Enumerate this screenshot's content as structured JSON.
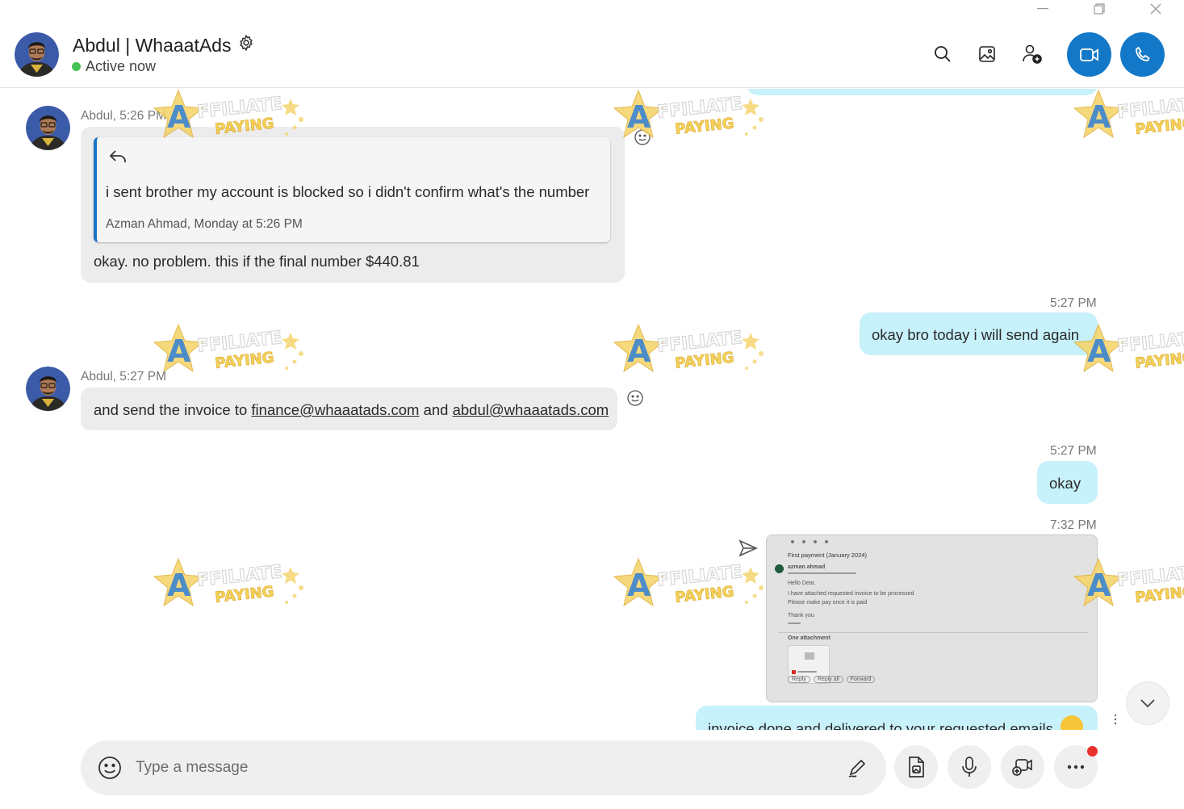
{
  "window": {
    "minimize_icon": "minimize-icon",
    "restore_icon": "restore-icon",
    "close_icon": "close-icon"
  },
  "header": {
    "name": "Abdul | WhaaatAds",
    "status": "Active now",
    "status_color": "#45c254",
    "icons": [
      "search-icon",
      "gallery-icon",
      "add-person-icon",
      "video-call-icon",
      "phone-call-icon"
    ],
    "accent": "#1378c7"
  },
  "messages": [
    {
      "direction": "in",
      "meta": "Abdul, 5:26 PM",
      "quote": {
        "text": "i sent brother my account is blocked so i didn't confirm what's the number",
        "meta": "Azman Ahmad, Monday at 5:26 PM"
      },
      "text": "okay. no problem. this if the final number $440.81"
    },
    {
      "direction": "out",
      "meta": "5:27 PM",
      "text": "okay bro today i will send again"
    },
    {
      "direction": "in",
      "meta": "Abdul, 5:27 PM",
      "text_before": "and send the invoice to ",
      "link1": "finance@whaaatads.com",
      "text_mid": " and ",
      "link2": "abdul@whaaatads.com"
    },
    {
      "direction": "out",
      "meta": "5:27 PM",
      "text": "okay"
    },
    {
      "direction": "out",
      "meta": "7:32 PM",
      "attachment": {
        "subject": "First payment (January 2024)",
        "sender": "azman ahmad",
        "greeting": "Hello Dear,",
        "body1": "I have attached requested invoice to be processed",
        "body2": "Please make pay once it is paid",
        "signoff": "Thank you",
        "attachments_label": "One attachment",
        "reply": "Reply",
        "reply_all": "Reply all",
        "forward": "Forward"
      },
      "text": "invoice done and delivered to your requested emails"
    }
  ],
  "watermark": {
    "line1": "FFILIATE",
    "line2": "PAYING",
    "letter": "A"
  },
  "composer": {
    "placeholder": "Type a message",
    "icons": [
      "emoji-icon",
      "pen-icon",
      "file-icon",
      "microphone-icon",
      "video-message-icon",
      "more-icon"
    ]
  },
  "colors": {
    "incoming_bubble": "#ececec",
    "outgoing_bubble": "#c7f1fb",
    "quote_border": "#1b73c8",
    "notification_dot": "#e8322b"
  }
}
